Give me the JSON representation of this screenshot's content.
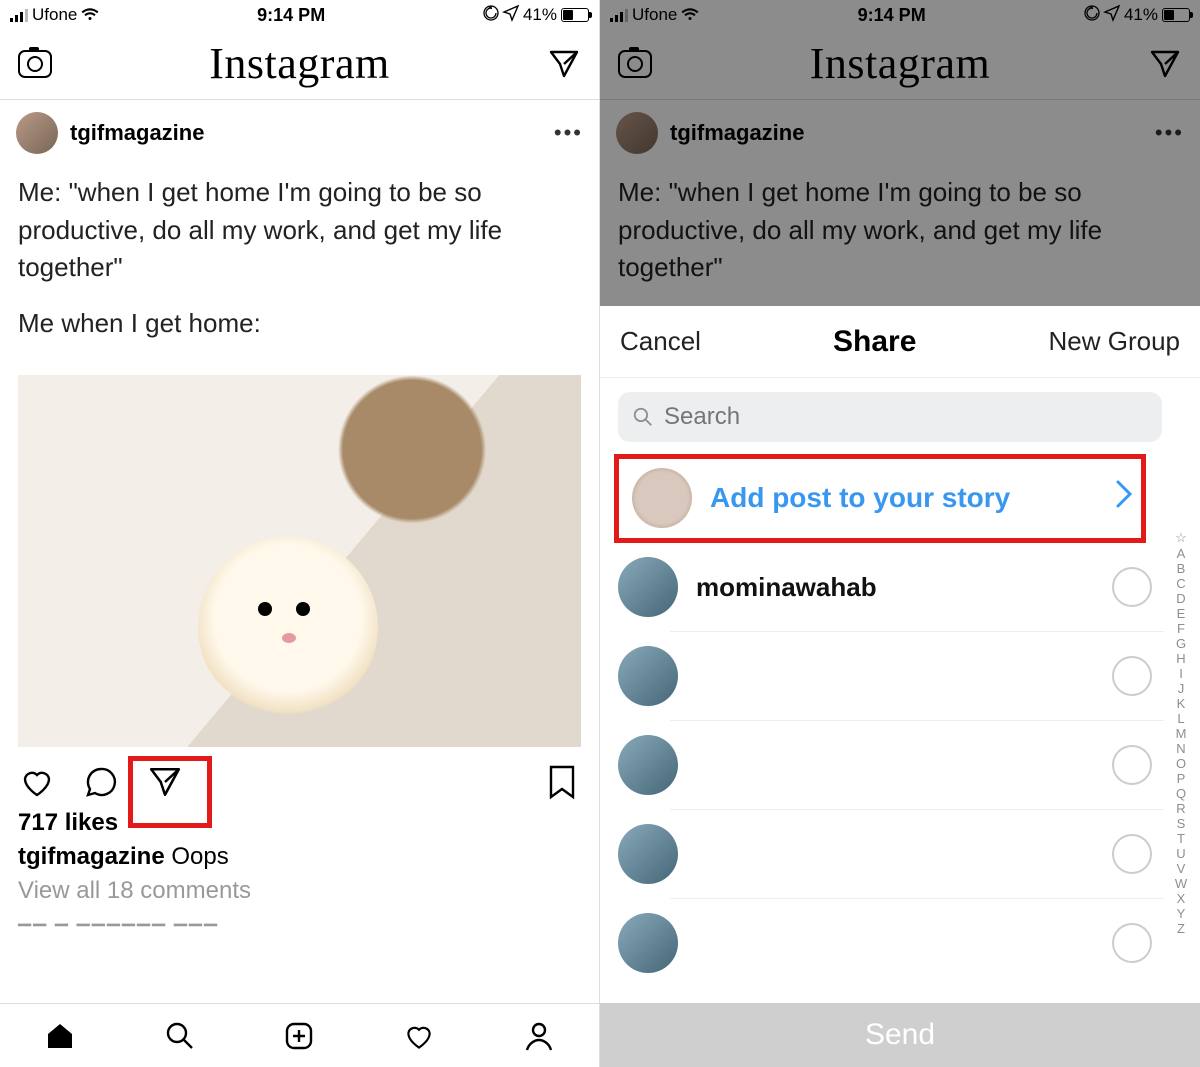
{
  "status": {
    "carrier": "Ufone",
    "time": "9:14 PM",
    "battery_pct": "41%"
  },
  "header": {
    "logo": "Instagram"
  },
  "post": {
    "username": "tgifmagazine",
    "caption_line1": "Me: \"when I get home I'm going to be so productive, do all my work, and get my life together\"",
    "caption_line2": "Me when I get home:",
    "likes": "717 likes",
    "caption_user": "tgifmagazine",
    "caption_text": "Oops",
    "view_comments": "View all 18 comments"
  },
  "share_sheet": {
    "cancel": "Cancel",
    "title": "Share",
    "new_group": "New Group",
    "search_placeholder": "Search",
    "add_story_label": "Add post to your story",
    "contacts": [
      {
        "name": "mominawahab"
      },
      {
        "name": ""
      },
      {
        "name": ""
      },
      {
        "name": ""
      },
      {
        "name": ""
      }
    ],
    "index": [
      "☆",
      "A",
      "B",
      "C",
      "D",
      "E",
      "F",
      "G",
      "H",
      "I",
      "J",
      "K",
      "L",
      "M",
      "N",
      "O",
      "P",
      "Q",
      "R",
      "S",
      "T",
      "U",
      "V",
      "W",
      "X",
      "Y",
      "Z"
    ],
    "send_label": "Send"
  }
}
